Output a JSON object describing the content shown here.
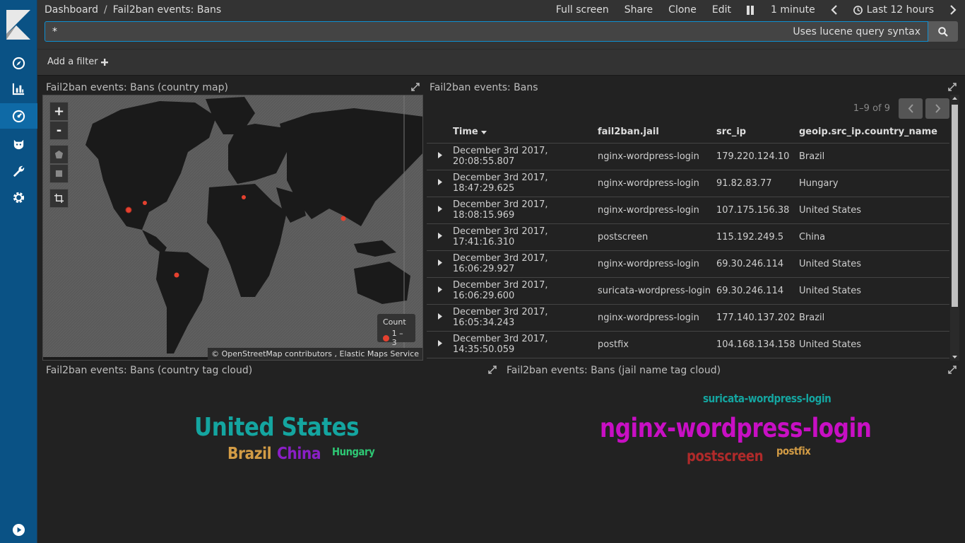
{
  "breadcrumb": {
    "root": "Dashboard",
    "sep": "/",
    "current": "Fail2ban events: Bans"
  },
  "top_actions": {
    "fullscreen": "Full screen",
    "share": "Share",
    "clone": "Clone",
    "edit": "Edit",
    "interval": "1 minute",
    "time_range": "Last 12 hours"
  },
  "query": {
    "value": "*",
    "hint": "Uses lucene query syntax"
  },
  "filter": {
    "add_label": "Add a filter"
  },
  "map_panel": {
    "title": "Fail2ban events: Bans (country map)",
    "zoom_in": "+",
    "zoom_out": "-",
    "legend_title": "Count",
    "legend_range": "1 – 3",
    "attribution": "© OpenStreetMap contributors , Elastic Maps Service",
    "marker_color": "#e5412f"
  },
  "table_panel": {
    "title": "Fail2ban events: Bans",
    "pager": "1–9 of 9",
    "columns": [
      "Time",
      "fail2ban.jail",
      "src_ip",
      "geoip.src_ip.country_name"
    ],
    "rows": [
      [
        "December 3rd 2017, 20:08:55.807",
        "nginx-wordpress-login",
        "179.220.124.10",
        "Brazil"
      ],
      [
        "December 3rd 2017, 18:47:29.625",
        "nginx-wordpress-login",
        "91.82.83.77",
        "Hungary"
      ],
      [
        "December 3rd 2017, 18:08:15.969",
        "nginx-wordpress-login",
        "107.175.156.38",
        "United States"
      ],
      [
        "December 3rd 2017, 17:41:16.310",
        "postscreen",
        "115.192.249.5",
        "China"
      ],
      [
        "December 3rd 2017, 16:06:29.927",
        "nginx-wordpress-login",
        "69.30.246.114",
        "United States"
      ],
      [
        "December 3rd 2017, 16:06:29.600",
        "suricata-wordpress-login",
        "69.30.246.114",
        "United States"
      ],
      [
        "December 3rd 2017, 16:05:34.243",
        "nginx-wordpress-login",
        "177.140.137.202",
        "Brazil"
      ],
      [
        "December 3rd 2017, 14:35:50.059",
        "postfix",
        "104.168.134.158",
        "United States"
      ]
    ]
  },
  "country_cloud": {
    "title": "Fail2ban events: Bans (country tag cloud)",
    "words": [
      {
        "text": "United States",
        "color": "#14a5a0"
      },
      {
        "text": "Brazil",
        "color": "#d39c45"
      },
      {
        "text": "China",
        "color": "#8a1fc6"
      },
      {
        "text": "Hungary",
        "color": "#2ec975"
      }
    ]
  },
  "jail_cloud": {
    "title": "Fail2ban events: Bans (jail name tag cloud)",
    "words": [
      {
        "text": "suricata-wordpress-login",
        "color": "#14a5a0"
      },
      {
        "text": "nginx-wordpress-login",
        "color": "#c80fc4"
      },
      {
        "text": "postscreen",
        "color": "#b02a2a"
      },
      {
        "text": "postfix",
        "color": "#d39c45"
      }
    ]
  },
  "sidebar": {
    "items": [
      "discover-icon",
      "visualize-icon",
      "dashboard-icon",
      "timelion-icon",
      "devtools-icon",
      "management-icon",
      "collapse-icon"
    ],
    "active": "dashboard-icon",
    "accent": "#0a5285"
  }
}
